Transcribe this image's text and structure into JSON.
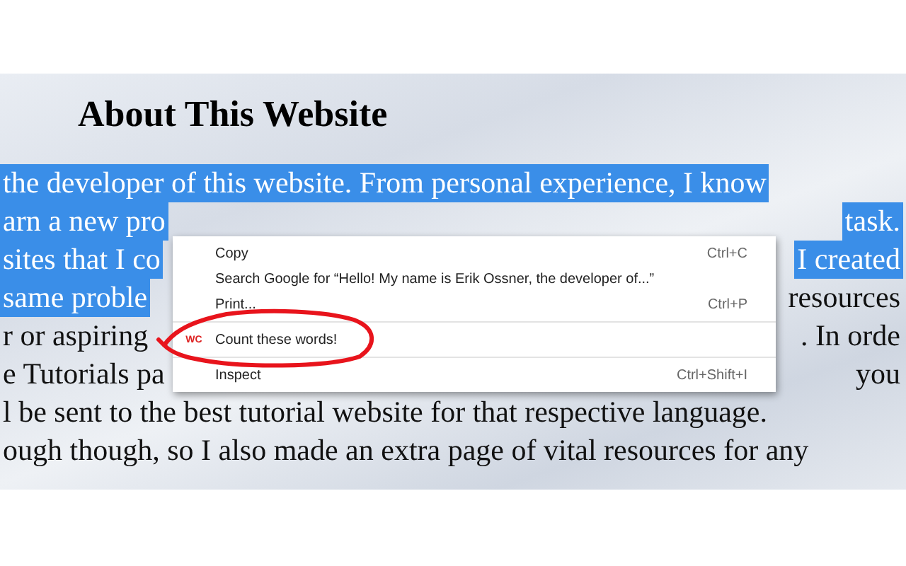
{
  "heading": "About This Website",
  "lines": [
    {
      "left": {
        "text": "the developer of this website. From personal experience, I know",
        "selected": true
      }
    },
    {
      "left": {
        "text": "arn a new pro",
        "selected": true
      },
      "right": {
        "text": "task.",
        "selected": true
      }
    },
    {
      "left": {
        "text": "sites that I co",
        "selected": true
      },
      "right": {
        "text": "I created",
        "selected": true
      }
    },
    {
      "left": {
        "text": "same proble",
        "selected": true
      },
      "right": {
        "text": "resources",
        "selected": false
      }
    },
    {
      "left": {
        "text": "r or aspiring",
        "selected": false
      },
      "right": {
        "text": ". In orde",
        "selected": false
      }
    },
    {
      "left": {
        "text": "e Tutorials pa",
        "selected": false
      },
      "right": {
        "text": "you",
        "selected": false
      }
    },
    {
      "left": {
        "text": "l be sent to the best tutorial website for that respective language.",
        "selected": false
      }
    },
    {
      "left": {
        "text": "ough though, so I also made an extra page of vital resources for any",
        "selected": false
      }
    }
  ],
  "context_menu": {
    "items": [
      {
        "kind": "item",
        "label": "Copy",
        "shortcut": "Ctrl+C"
      },
      {
        "kind": "item",
        "label": "Search Google for “Hello! My name is Erik Ossner, the developer of...”"
      },
      {
        "kind": "item",
        "label": "Print...",
        "shortcut": "Ctrl+P"
      },
      {
        "kind": "separator"
      },
      {
        "kind": "extension",
        "icon_text": "WC",
        "label": "Count these words!",
        "circled": true
      },
      {
        "kind": "separator"
      },
      {
        "kind": "item",
        "label": "Inspect",
        "shortcut": "Ctrl+Shift+I"
      }
    ]
  }
}
